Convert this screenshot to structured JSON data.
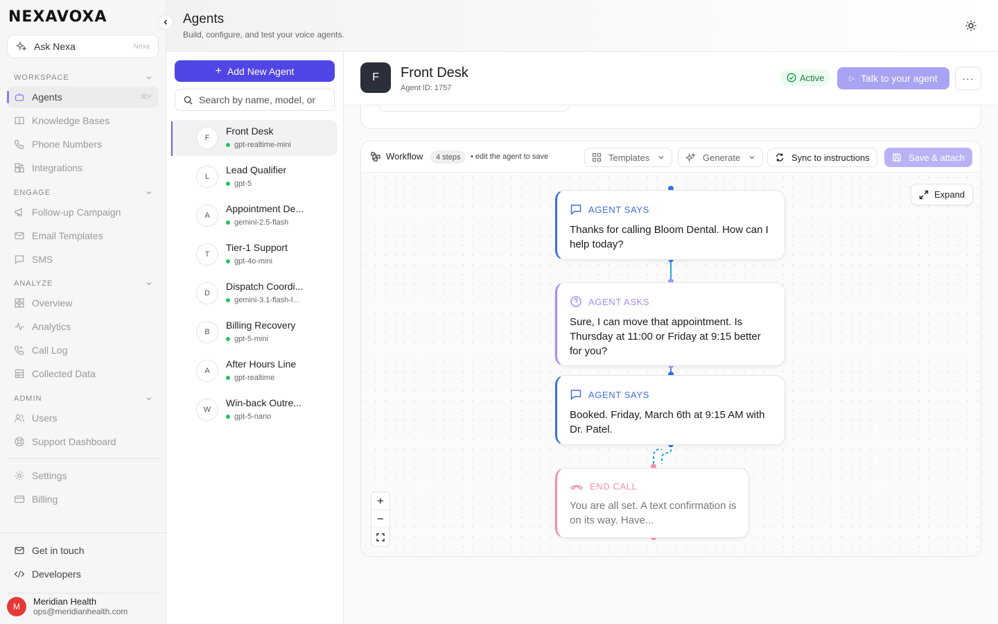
{
  "brand": {
    "logo": "NEXAVOXA"
  },
  "ask": {
    "label": "Ask Nexa",
    "shortcut": "Nexa"
  },
  "sidebar": {
    "sections": [
      {
        "title": "WORKSPACE"
      },
      {
        "title": "ENGAGE"
      },
      {
        "title": "ANALYZE"
      },
      {
        "title": "ADMIN"
      }
    ],
    "items": [
      {
        "label": "Agents",
        "shortcut": "⌘P",
        "icon": "robot-icon"
      },
      {
        "label": "Knowledge Bases",
        "icon": "book-icon"
      },
      {
        "label": "Phone Numbers",
        "icon": "phone-icon"
      },
      {
        "label": "Integrations",
        "icon": "puzzle-icon"
      },
      {
        "label": "Follow-up Campaign",
        "icon": "megaphone-icon"
      },
      {
        "label": "Email Templates",
        "icon": "mail-icon"
      },
      {
        "label": "SMS",
        "icon": "chat-icon"
      },
      {
        "label": "Overview",
        "icon": "grid-icon"
      },
      {
        "label": "Analytics",
        "icon": "pulse-icon"
      },
      {
        "label": "Call Log",
        "icon": "phone-log-icon"
      },
      {
        "label": "Collected Data",
        "icon": "table-icon"
      },
      {
        "label": "Users",
        "icon": "users-icon"
      },
      {
        "label": "Support Dashboard",
        "icon": "lifebuoy-icon"
      },
      {
        "label": "Settings",
        "icon": "gear-icon"
      },
      {
        "label": "Billing",
        "icon": "card-icon"
      }
    ],
    "footer": [
      {
        "label": "Get in touch",
        "icon": "mail-icon"
      },
      {
        "label": "Developers",
        "icon": "code-icon"
      }
    ],
    "user": {
      "initial": "M",
      "name": "Meridian Health",
      "email": "ops@meridianhealth.com"
    }
  },
  "header": {
    "title": "Agents",
    "subtitle": "Build, configure, and test your voice agents."
  },
  "list": {
    "add_label": "Add New Agent",
    "search_placeholder": "Search by name, model, or ID",
    "agents": [
      {
        "initial": "F",
        "name": "Front Desk",
        "model": "gpt-realtime-mini"
      },
      {
        "initial": "L",
        "name": "Lead Qualifier",
        "model": "gpt-5"
      },
      {
        "initial": "A",
        "name": "Appointment De...",
        "model": "gemini-2.5-flash"
      },
      {
        "initial": "T",
        "name": "Tier-1 Support",
        "model": "gpt-4o-mini"
      },
      {
        "initial": "D",
        "name": "Dispatch Coordi...",
        "model": "gemini-3.1-flash-l..."
      },
      {
        "initial": "B",
        "name": "Billing Recovery",
        "model": "gpt-5-mini"
      },
      {
        "initial": "A",
        "name": "After Hours Line",
        "model": "gpt-realtime"
      },
      {
        "initial": "W",
        "name": "Win-back Outre...",
        "model": "gpt-5-nano"
      }
    ]
  },
  "agent": {
    "initial": "F",
    "name": "Front Desk",
    "id_text": "Agent ID: 1757",
    "status": "Active",
    "talk_label": "Talk to your agent",
    "more_label": "···"
  },
  "workflow": {
    "label": "Workflow",
    "steps": "4 steps",
    "hint": "• edit the agent to save",
    "templates_label": "Templates",
    "generate_label": "Generate",
    "sync_label": "Sync to instructions",
    "save_label": "Save & attach",
    "expand_label": "Expand",
    "nodes": [
      {
        "kind": "AGENT SAYS",
        "text": "Thanks for calling Bloom Dental. How can I help today?"
      },
      {
        "kind": "AGENT ASKS",
        "text": "Sure, I can move that appointment. Is Thursday at 11:00 or Friday at 9:15 better for you?"
      },
      {
        "kind": "AGENT SAYS",
        "text": "Booked. Friday, March 6th at 9:15 AM with Dr. Patel."
      },
      {
        "kind": "END CALL",
        "text": "You are all set. A text confirmation is on its way. Have..."
      }
    ],
    "zoom": {
      "in": "+",
      "out": "−",
      "fit": "⛶"
    }
  },
  "colors": {
    "accent": "#4f46e5",
    "says": "#3b6fe0",
    "asks": "#a78bfa",
    "end": "#f48fb1",
    "active": "#22c55e"
  }
}
